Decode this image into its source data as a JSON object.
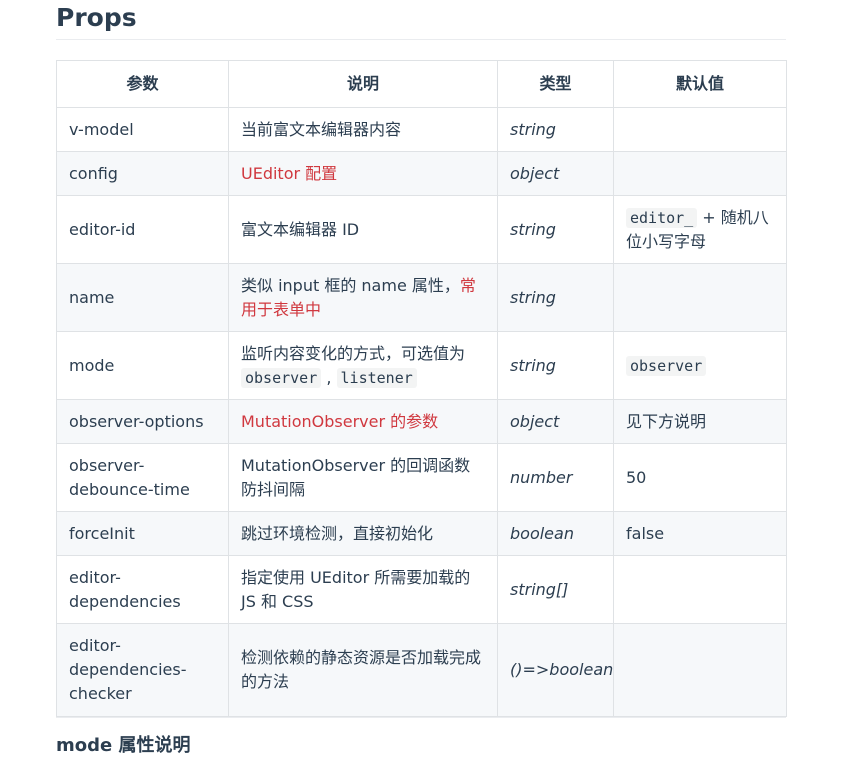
{
  "heading": "Props",
  "table": {
    "headers": [
      "参数",
      "说明",
      "类型",
      "默认值"
    ],
    "rows": [
      {
        "param": "v-model",
        "desc": "当前富文本编辑器内容",
        "type": "string",
        "default": ""
      },
      {
        "param": "config",
        "desc": "UEditor 配置",
        "type": "object",
        "default": ""
      },
      {
        "param": "editor-id",
        "desc": "富文本编辑器 ID",
        "type": "string",
        "default_code": "editor_",
        "default_rest": " + 随机八位小写字母"
      },
      {
        "param": "name",
        "desc_plain": "类似 input 框的 name 属性，",
        "desc_red": "常用于表单中",
        "type": "string",
        "default": ""
      },
      {
        "param": "mode",
        "desc_pre": "监听内容变化的方式，可选值为 ",
        "desc_code1": "observer",
        "desc_sep": " , ",
        "desc_code2": "listener",
        "type": "string",
        "default_code": "observer"
      },
      {
        "param": "observer-options",
        "desc": "MutationObserver 的参数",
        "type": "object",
        "default": "见下方说明"
      },
      {
        "param": "observer-debounce-time",
        "desc": "MutationObserver 的回调函数防抖间隔",
        "type": "number",
        "default": "50"
      },
      {
        "param": "forceInit",
        "desc": "跳过环境检测，直接初始化",
        "type": "boolean",
        "default": "false"
      },
      {
        "param": "editor-dependencies",
        "desc": "指定使用 UEditor 所需要加载的 JS 和 CSS",
        "type": "string[]",
        "default": ""
      },
      {
        "param": "editor-dependencies-checker",
        "desc": "检测依赖的静态资源是否加载完成的方法",
        "type": "()=>boolean",
        "default": ""
      }
    ]
  },
  "next_heading": "mode 属性说明",
  "colors": {
    "text": "#2c3e50",
    "link_red": "#d0383f",
    "border": "#dfe2e5",
    "stripe": "#f6f8fa"
  }
}
